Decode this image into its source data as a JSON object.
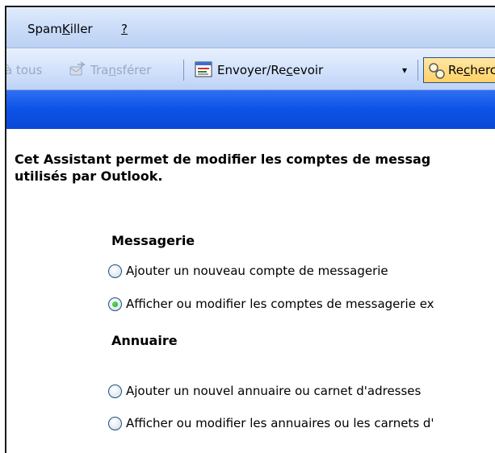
{
  "menubar": {
    "items": [
      {
        "pre": "Spam",
        "accel": "K",
        "post": "iller"
      },
      {
        "pre": "",
        "accel": "?",
        "post": ""
      }
    ]
  },
  "toolbar": {
    "reply_all_label": "à tous",
    "forward": {
      "pre": "Tra",
      "accel": "n",
      "post": "sférer"
    },
    "send_receive": {
      "pre": "Envoyer/Re",
      "accel": "c",
      "post": "evoir"
    },
    "dropdown_glyph": "▾",
    "search": {
      "pre": "Re",
      "accel": "c",
      "post": "herche"
    }
  },
  "wizard": {
    "intro_line1": "Cet Assistant permet de modifier les comptes de messag",
    "intro_line2": "utilisés par Outlook.",
    "sections": [
      {
        "title": "Messagerie",
        "options": [
          {
            "label": "Ajouter un nouveau compte de messagerie",
            "checked": false
          },
          {
            "label": "Afficher ou modifier les comptes de messagerie ex",
            "checked": true
          }
        ]
      },
      {
        "title": "Annuaire",
        "options": [
          {
            "label": "Ajouter un nouvel annuaire ou carnet d'adresses",
            "checked": false
          },
          {
            "label": "Afficher ou modifier les annuaires ou les carnets d'",
            "checked": false
          }
        ]
      }
    ]
  },
  "colors": {
    "banner_blue": "#0c52e6",
    "toolbar_bg": "#cfe0fb",
    "radio_checked": "#21a121"
  }
}
